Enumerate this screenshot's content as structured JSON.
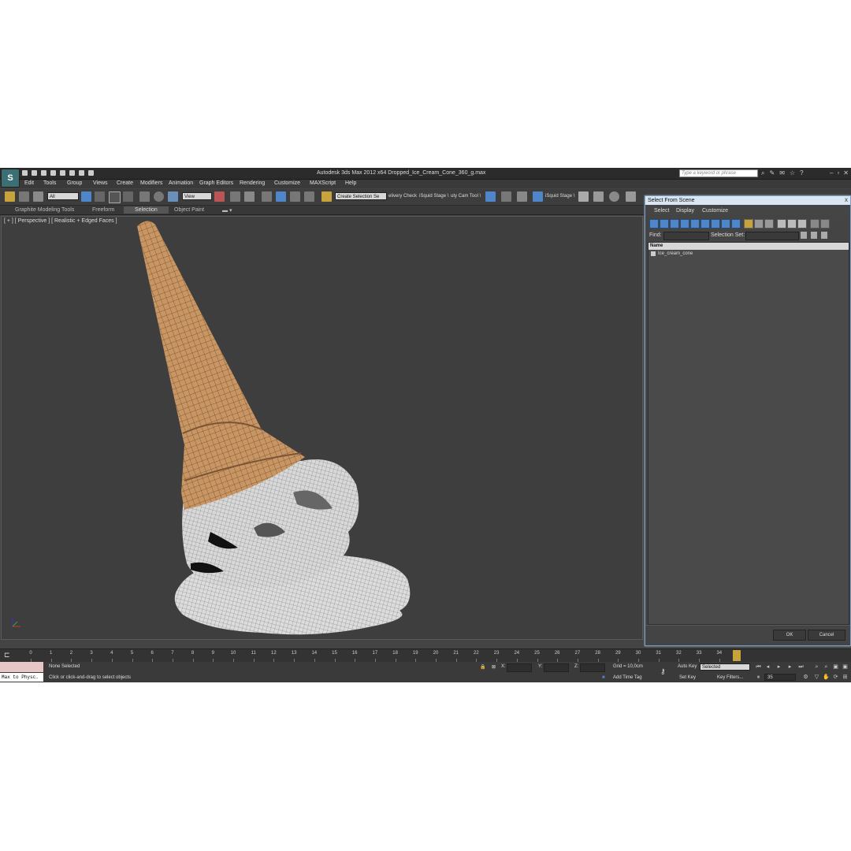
{
  "window": {
    "title": "Autodesk 3ds Max  2012 x64      Dropped_Ice_Cream_Cone_360_g.max",
    "search_placeholder": "Type a keyword or phrase",
    "logo_label": "S"
  },
  "menu": [
    "Edit",
    "Tools",
    "Group",
    "Views",
    "Create",
    "Modifiers",
    "Animation",
    "Graph Editors",
    "Rendering",
    "Customize",
    "MAXScript",
    "Help"
  ],
  "toolbar": {
    "filter_value": "All",
    "view_value": "View",
    "selection_set": "Create Selection Se",
    "delivery_check": "elivery Check",
    "squid_stage": "iSquid Stage \\",
    "city_cam": "uty Cam Tool \\",
    "squid_stage_2": "iSquid Stage \\"
  },
  "ribbon": {
    "tabs": [
      "Graphite Modeling Tools",
      "Freeform",
      "Selection",
      "Object Paint"
    ],
    "active_tab": "Selection"
  },
  "viewport": {
    "label": "[ + ] [ Perspective ] [ Realistic + Edged Faces ]"
  },
  "select_dialog": {
    "title": "Select From Scene",
    "close": "x",
    "menu": [
      "Select",
      "Display",
      "Customize"
    ],
    "find_label": "Find:",
    "selection_set_label": "Selection Set:",
    "column_name": "Name",
    "items": [
      "Ice_cream_cone"
    ],
    "ok_label": "OK",
    "cancel_label": "Cancel"
  },
  "timeline": {
    "ticks": [
      0,
      1,
      2,
      3,
      4,
      5,
      6,
      7,
      8,
      9,
      10,
      11,
      12,
      13,
      14,
      15,
      16,
      17,
      18,
      19,
      20,
      21,
      22,
      23,
      24,
      25,
      26,
      27,
      28,
      29,
      30,
      31,
      32,
      33,
      34
    ]
  },
  "status": {
    "maxscript_text": "Max to Physc.",
    "selection_status": "None Selected",
    "prompt": "Click or click-and-drag to select objects",
    "x_label": "X:",
    "y_label": "Y:",
    "z_label": "Z:",
    "grid": "Grid = 10,0cm",
    "add_time_tag": "Add Time Tag",
    "auto_key": "Auto Key",
    "set_key": "Set Key",
    "auto_key_value": "Selected",
    "key_filters": "Key Filters...",
    "frame_value": "35"
  }
}
